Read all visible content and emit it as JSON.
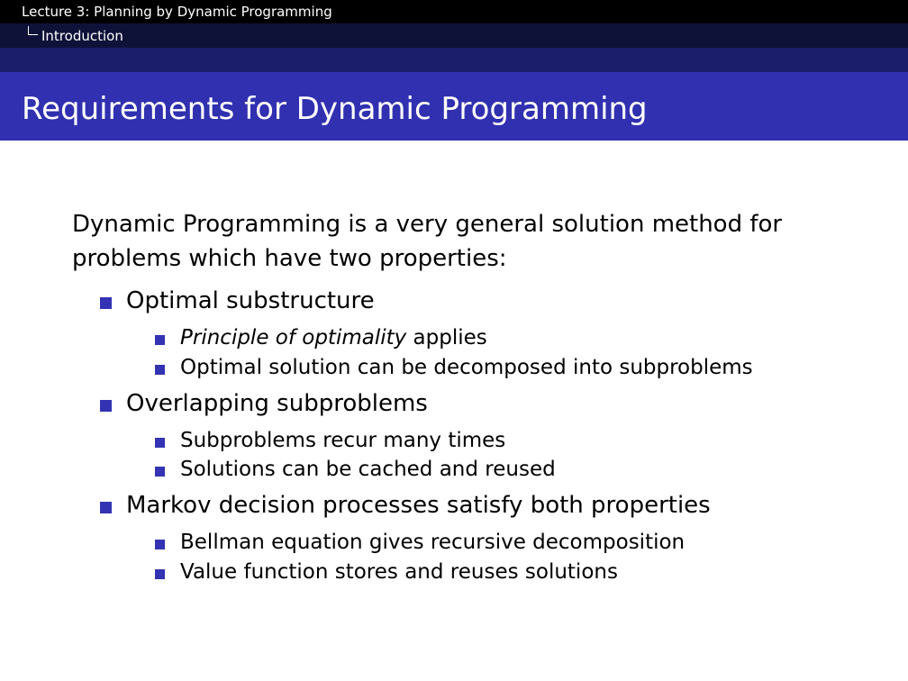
{
  "header": {
    "lecture": "Lecture 3: Planning by Dynamic Programming",
    "section": "Introduction"
  },
  "slide": {
    "title": "Requirements for Dynamic Programming",
    "intro": "Dynamic Programming is a very general solution method for problems which have two properties:",
    "items": [
      {
        "label": "Optimal substructure",
        "subitems": [
          {
            "emphasis": "Principle of optimality",
            "text": " applies"
          },
          {
            "text": "Optimal solution can be decomposed into subproblems"
          }
        ]
      },
      {
        "label": "Overlapping subproblems",
        "subitems": [
          {
            "text": "Subproblems recur many times"
          },
          {
            "text": "Solutions can be cached and reused"
          }
        ]
      },
      {
        "label": "Markov decision processes satisfy both properties",
        "subitems": [
          {
            "text": "Bellman equation gives recursive decomposition"
          },
          {
            "text": "Value function stores and reuses solutions"
          }
        ]
      }
    ]
  },
  "colors": {
    "header_black": "#000000",
    "header_dark_navy": "#0f1238",
    "header_navy": "#1b1f6b",
    "title_blue": "#3030b0",
    "bullet_blue": "#3333b3"
  }
}
